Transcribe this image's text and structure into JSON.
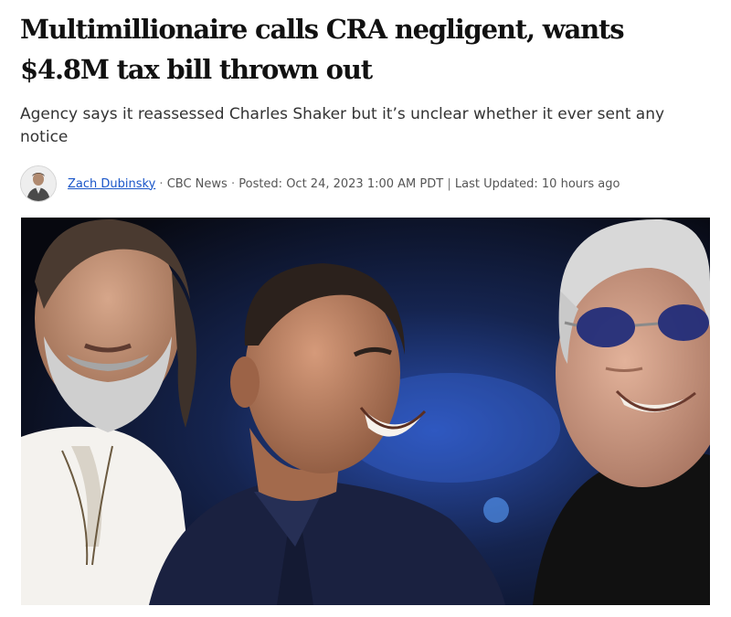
{
  "article": {
    "headline": "Multimillionaire calls CRA negligent, wants $4.8M tax bill thrown out",
    "dek": "Agency says it reassessed Charles Shaker but it’s unclear whether it ever sent any notice",
    "byline": {
      "author": "Zach Dubinsky",
      "separator_dot": "·",
      "source": "CBC News",
      "posted_label": "Posted: Oct 24, 2023 1:00 AM PDT",
      "separator_bar": "|",
      "updated_label": "Last Updated: 10 hours ago",
      "avatar_icon": "author-avatar"
    },
    "photo": {
      "subject": "photo-three-men-smiling"
    }
  },
  "colors": {
    "link": "#1a56c9",
    "headline": "#111111",
    "dek": "#333333",
    "meta": "#555555"
  }
}
